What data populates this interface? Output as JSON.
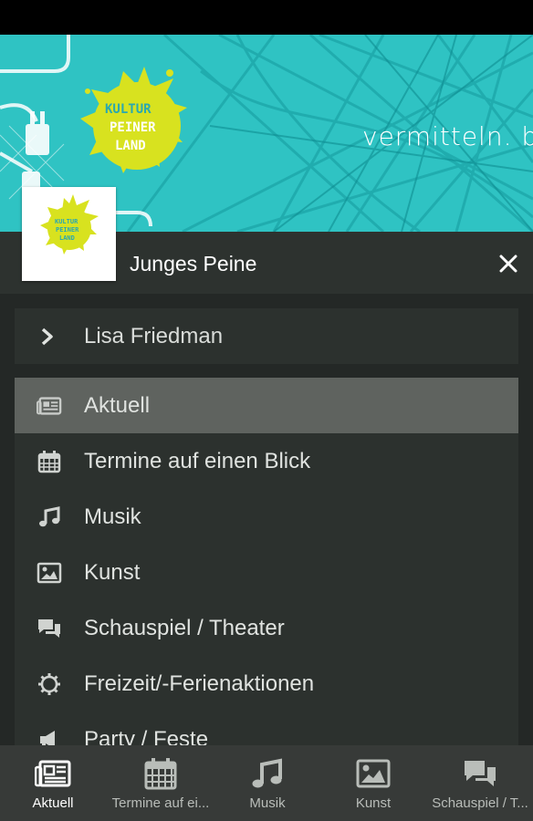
{
  "banner": {
    "logo_text": [
      "KULTUR",
      "PEINER",
      "LAND"
    ],
    "slogan": "vermitteln. b"
  },
  "header": {
    "title": "Junges Peine",
    "close_icon": "close-icon"
  },
  "user": {
    "name": "Lisa Friedman",
    "icon": "chevron-right-icon"
  },
  "menu": [
    {
      "label": "Aktuell",
      "icon": "newspaper-icon",
      "active": true
    },
    {
      "label": "Termine auf einen Blick",
      "icon": "calendar-icon",
      "active": false
    },
    {
      "label": "Musik",
      "icon": "music-note-icon",
      "active": false
    },
    {
      "label": "Kunst",
      "icon": "picture-icon",
      "active": false
    },
    {
      "label": "Schauspiel / Theater",
      "icon": "chat-bubbles-icon",
      "active": false
    },
    {
      "label": "Freizeit/-Ferienaktionen",
      "icon": "gear-icon",
      "active": false
    },
    {
      "label": "Party / Feste",
      "icon": "bullhorn-icon",
      "active": false
    }
  ],
  "bottom_nav": [
    {
      "label": "Aktuell",
      "icon": "newspaper-icon",
      "active": true
    },
    {
      "label": "Termine auf ei...",
      "icon": "calendar-icon",
      "active": false
    },
    {
      "label": "Musik",
      "icon": "music-note-icon",
      "active": false
    },
    {
      "label": "Kunst",
      "icon": "picture-icon",
      "active": false
    },
    {
      "label": "Schauspiel / T...",
      "icon": "chat-bubbles-icon",
      "active": false
    }
  ],
  "colors": {
    "banner_teal": "#2fc3c3",
    "logo_yellow": "#d8e21f",
    "active_row": "#5f635f"
  }
}
